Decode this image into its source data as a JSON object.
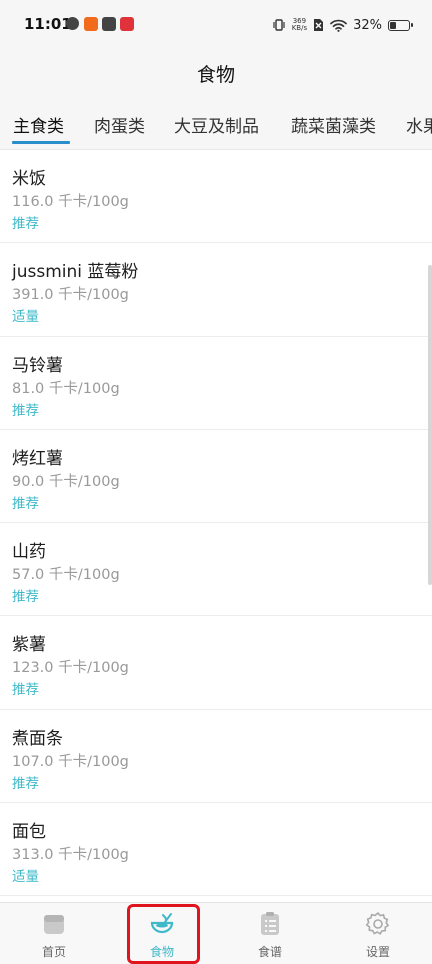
{
  "status_bar": {
    "time": "11:01",
    "net_speed_value": "369",
    "net_speed_unit": "KB/s",
    "battery": "32%",
    "battery_level": 0.32
  },
  "header": {
    "title": "食物"
  },
  "tabs": [
    {
      "label": "主食类",
      "active": true
    },
    {
      "label": "肉蛋类"
    },
    {
      "label": "大豆及制品"
    },
    {
      "label": "蔬菜菌藻类"
    },
    {
      "label": "水果"
    }
  ],
  "foods": [
    {
      "name": "米饭",
      "calories": "116.0 千卡/100g",
      "tag": "推荐"
    },
    {
      "name": "jussmini 蓝莓粉",
      "calories": "391.0 千卡/100g",
      "tag": "适量"
    },
    {
      "name": "马铃薯",
      "calories": "81.0 千卡/100g",
      "tag": "推荐"
    },
    {
      "name": "烤红薯",
      "calories": "90.0 千卡/100g",
      "tag": "推荐"
    },
    {
      "name": "山药",
      "calories": "57.0 千卡/100g",
      "tag": "推荐"
    },
    {
      "name": "紫薯",
      "calories": "123.0 千卡/100g",
      "tag": "推荐"
    },
    {
      "name": "煮面条",
      "calories": "107.0 千卡/100g",
      "tag": "推荐"
    },
    {
      "name": "面包",
      "calories": "313.0 千卡/100g",
      "tag": "适量"
    }
  ],
  "bottom_nav": [
    {
      "label": "首页",
      "icon": "home-icon"
    },
    {
      "label": "食物",
      "icon": "food-bowl-icon",
      "active": true
    },
    {
      "label": "食谱",
      "icon": "recipe-list-icon"
    },
    {
      "label": "设置",
      "icon": "gear-icon"
    }
  ],
  "colors": {
    "accent": "#3fb9c9",
    "tab_indicator": "#2a8ecb",
    "highlight": "#e0141e"
  }
}
